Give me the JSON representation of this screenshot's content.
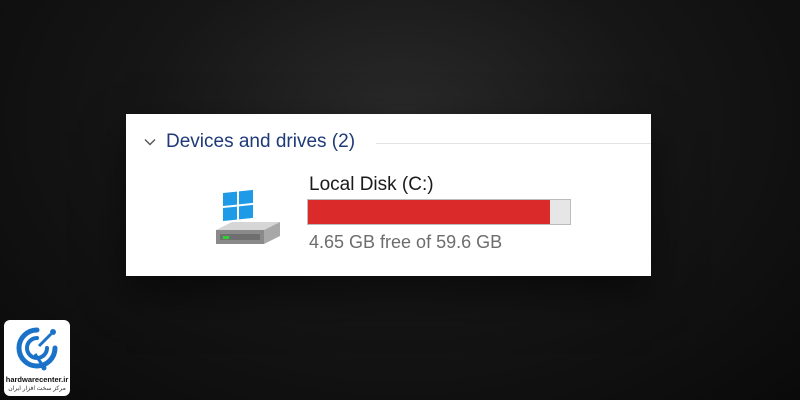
{
  "group": {
    "title": "Devices and drives (2)",
    "expanded": true
  },
  "drive": {
    "name": "Local Disk (C:)",
    "space_text": "4.65 GB free of 59.6 GB",
    "free_gb": 4.65,
    "total_gb": 59.6,
    "used_fraction": 0.922,
    "bar_color": "#da2a2a",
    "icon": "windows-drive-icon"
  },
  "watermark": {
    "name": "hardwarecenter.ir",
    "subtitle": "مرکز سخت افزار ایران",
    "accent_color": "#1a73c8"
  }
}
